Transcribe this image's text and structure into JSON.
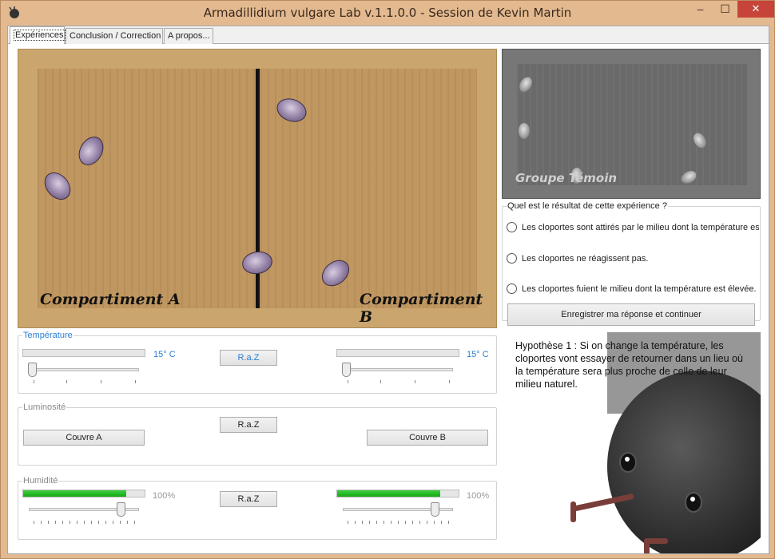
{
  "window": {
    "title": "Armadillidium vulgare Lab v.1.1.0.0 - Session de Kevin Martin",
    "minimize": "–",
    "maximize": "☐",
    "close": "✕"
  },
  "tabs": [
    {
      "label": "Expériences",
      "active": true
    },
    {
      "label": "Conclusion / Correction",
      "active": false
    },
    {
      "label": "A propos...",
      "active": false
    }
  ],
  "experiment": {
    "compartment_a": "Compartiment A",
    "compartment_b": "Compartiment B"
  },
  "control_group": {
    "label": "Groupe Témoin"
  },
  "question": {
    "legend": "Quel est le résultat de cette expérience ?",
    "options": [
      "Les cloportes sont attirés par le milieu dont la température est élevée.",
      "Les cloportes ne réagissent pas.",
      "Les cloportes fuient le milieu dont la température est élevée."
    ],
    "submit": "Enregistrer ma réponse et continuer"
  },
  "temperature": {
    "legend": "Température",
    "left_value": "15° C",
    "right_value": "15° C",
    "reset": "R.a.Z",
    "left_slider_level": 0,
    "right_slider_level": 0
  },
  "luminosity": {
    "legend": "Luminosité",
    "reset": "R.a.Z",
    "cover_a": "Couvre A",
    "cover_b": "Couvre B"
  },
  "humidity": {
    "legend": "Humidité",
    "left_value": "100%",
    "right_value": "100%",
    "reset": "R.a.Z",
    "left_level": 0.85,
    "right_level": 0.85
  },
  "hypothesis": "Hypothèse 1 : Si on change la température, les cloportes vont essayer de retourner dans un lieu où la température sera plus proche de celle de leur milieu naturel.",
  "colors": {
    "accent_blue": "#2a7fd4",
    "progress_green": "#18a818",
    "close_red": "#c7443a"
  }
}
